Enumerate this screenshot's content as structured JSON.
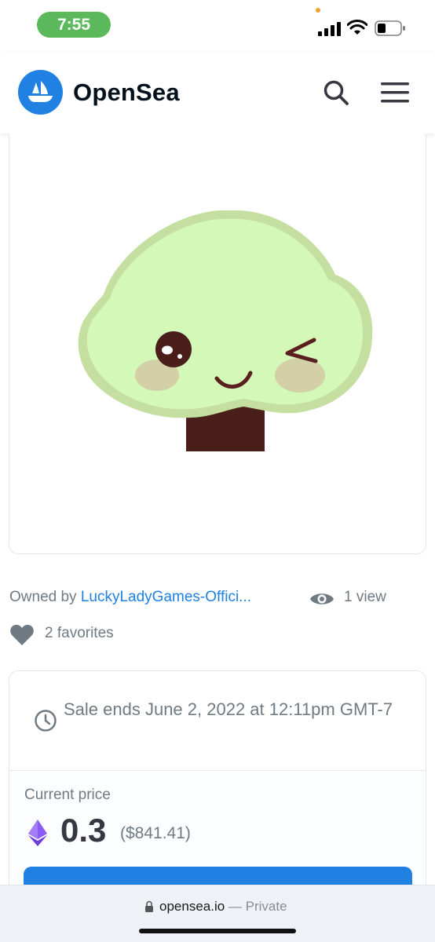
{
  "status_bar": {
    "time": "7:55"
  },
  "header": {
    "brand": "OpenSea",
    "brand_color": "#2081e2",
    "icons": [
      "search-icon",
      "hamburger-menu-icon"
    ]
  },
  "asset": {
    "owned_prefix": "Owned by ",
    "owner": "LuckyLadyGames-Offici...",
    "views": "1 view",
    "favorites": "2 favorites"
  },
  "sale": {
    "ends_text": "Sale ends June 2, 2022 at 12:11pm GMT-7",
    "price_label": "Current price",
    "price": "0.3",
    "price_usd": "($841.41)",
    "accent": "#2081e2"
  },
  "browser": {
    "domain": "opensea.io",
    "mode": " — Private"
  }
}
